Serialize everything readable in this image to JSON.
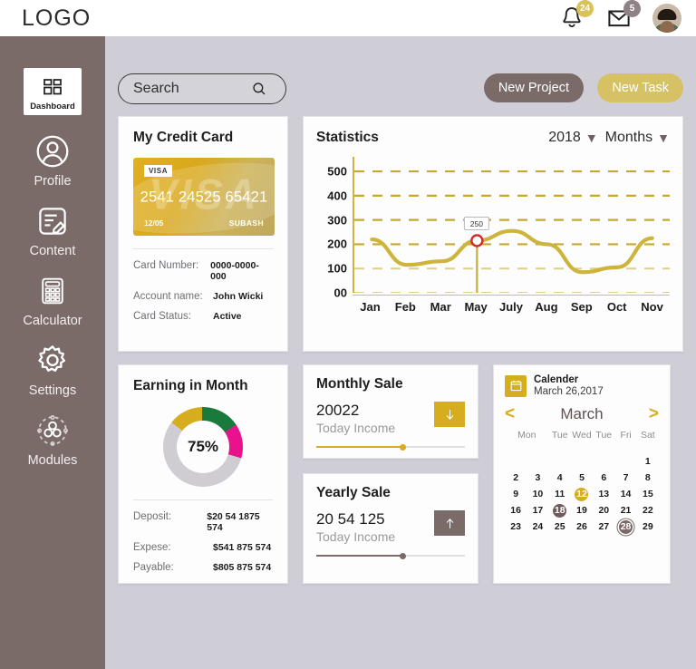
{
  "topbar": {
    "logo": "LOGO",
    "notifications": {
      "icon": "bell-icon",
      "count": "24"
    },
    "messages": {
      "icon": "mail-icon",
      "count": "5"
    },
    "avatar": "user-avatar"
  },
  "sidebar": {
    "items": [
      {
        "label": "Dashboard",
        "icon": "grid-icon",
        "active": true
      },
      {
        "label": "Profile",
        "icon": "user-icon",
        "active": false
      },
      {
        "label": "Content",
        "icon": "document-edit-icon",
        "active": false
      },
      {
        "label": "Calculator",
        "icon": "calculator-icon",
        "active": false
      },
      {
        "label": "Settings",
        "icon": "gear-icon",
        "active": false
      },
      {
        "label": "Modules",
        "icon": "modules-icon",
        "active": false
      }
    ]
  },
  "toolbar": {
    "search_placeholder": "Search",
    "search_value": "",
    "search_icon": "search-icon",
    "new_project": "New Project",
    "new_task": "New Task"
  },
  "credit_card": {
    "title": "My Credit Card",
    "brand": "VISA",
    "watermark": "VISA",
    "number_display": "2541 24525 65421",
    "expiry": "12/05",
    "holder": "SUBASH",
    "details": [
      {
        "label": "Card Number:",
        "value": "0000-0000-000"
      },
      {
        "label": "Account name:",
        "value": "John Wicki"
      },
      {
        "label": "Card Status:",
        "value": "Active"
      }
    ]
  },
  "statistics": {
    "title": "Statistics",
    "year": "2018",
    "period": "Months"
  },
  "chart_data": {
    "type": "line",
    "title": "Statistics",
    "xlabel": "",
    "ylabel": "",
    "categories": [
      "Jan",
      "Feb",
      "Mar",
      "May",
      "July",
      "Aug",
      "Sep",
      "Oct",
      "Nov"
    ],
    "values": [
      220,
      115,
      130,
      215,
      255,
      200,
      85,
      105,
      225
    ],
    "ytick_labels": [
      "500",
      "400",
      "300",
      "200",
      "100",
      "00"
    ],
    "ytick_values": [
      500,
      400,
      300,
      200,
      100,
      0
    ],
    "ylim": [
      0,
      560
    ],
    "grid": true,
    "line_color": "#cdb43c",
    "highlight": {
      "category": "May",
      "value": "250",
      "marker_color": "#d62828"
    },
    "legend": "none"
  },
  "earning": {
    "title": "Earning in Month",
    "percent": "75%",
    "donut": {
      "segments": [
        {
          "name": "gold",
          "color": "#d6ad1e",
          "percent": 14
        },
        {
          "name": "green",
          "color": "#1a7a3c",
          "percent": 16
        },
        {
          "name": "magenta",
          "color": "#e8138c",
          "percent": 14
        },
        {
          "name": "empty",
          "color": "#cfcdd2",
          "percent": 56
        }
      ]
    },
    "rows": [
      {
        "label": "Deposit:",
        "value": "$20 54 1875 574"
      },
      {
        "label": "Expese:",
        "value": "$541 875 574"
      },
      {
        "label": "Payable:",
        "value": "$805 875 574"
      }
    ]
  },
  "monthly_sale": {
    "title": "Monthly Sale",
    "amount": "20022",
    "subtitle": "Today Income",
    "button_icon": "arrow-down-icon"
  },
  "yearly_sale": {
    "title": "Yearly Sale",
    "amount": "20 54 125",
    "subtitle": "Today Income",
    "button_icon": "arrow-up-icon"
  },
  "calendar": {
    "icon": "calendar-icon",
    "title": "Calender",
    "date": "March 26,2017",
    "prev": "<",
    "next": ">",
    "month": "March",
    "dow": [
      "Mon",
      "Tue",
      "Wed",
      "Tue",
      "Fri",
      "Sat"
    ],
    "weeks": [
      [
        {
          "d": ""
        },
        {
          "d": ""
        },
        {
          "d": ""
        },
        {
          "d": ""
        },
        {
          "d": ""
        },
        {
          "d": ""
        },
        {
          "d": "1"
        }
      ],
      [
        {
          "d": "2"
        },
        {
          "d": "3"
        },
        {
          "d": "4"
        },
        {
          "d": "5"
        },
        {
          "d": "6"
        },
        {
          "d": "7"
        },
        {
          "d": "8"
        }
      ],
      [
        {
          "d": "9"
        },
        {
          "d": "10"
        },
        {
          "d": "11"
        },
        {
          "d": "12",
          "mark": "gold"
        },
        {
          "d": "13"
        },
        {
          "d": "14"
        },
        {
          "d": "15"
        }
      ],
      [
        {
          "d": "16"
        },
        {
          "d": "17"
        },
        {
          "d": "18",
          "mark": "brown"
        },
        {
          "d": "19"
        },
        {
          "d": "20"
        },
        {
          "d": "21"
        },
        {
          "d": "22"
        }
      ],
      [
        {
          "d": "23"
        },
        {
          "d": "24"
        },
        {
          "d": "25"
        },
        {
          "d": "26"
        },
        {
          "d": "27"
        },
        {
          "d": "28",
          "mark": "outline"
        },
        {
          "d": "29"
        }
      ]
    ]
  },
  "colors": {
    "sidebar": "#7a6a68",
    "page_bg": "#cfcdd6",
    "accent_gold": "#d6ad1e",
    "task_gold": "#d6c164"
  }
}
